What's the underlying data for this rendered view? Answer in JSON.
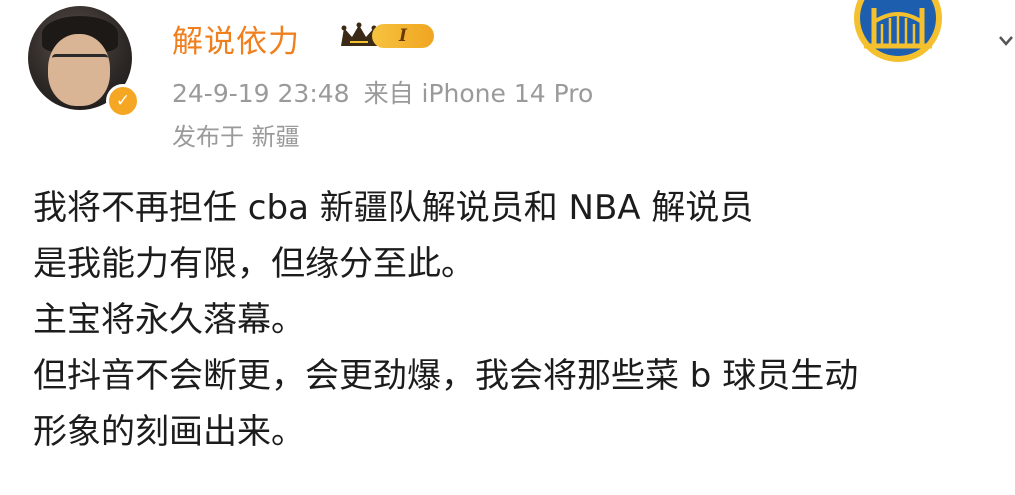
{
  "post": {
    "author": {
      "name": "解说依力",
      "vip_level": "I",
      "verified": true
    },
    "timestamp": "24-9-19 23:48",
    "source": "来自 iPhone 14 Pro",
    "location": "发布于 新疆",
    "content_lines": [
      "我将不再担任 cba 新疆队解说员和 NBA 解说员",
      "是我能力有限，但缘分至此。",
      "主宝将永久落幕。",
      "但抖音不会断更，会更劲爆，我会将那些菜 b 球员生动",
      "形象的刻画出来。"
    ]
  },
  "colors": {
    "username": "#f07f1e",
    "meta_text": "#9a9a9a",
    "verified_badge": "#f5a623",
    "vip_badge": "#f0a521",
    "team_logo_blue": "#1d5fae",
    "team_logo_gold": "#f5c02e"
  },
  "icons": {
    "verified": "verified-badge-icon",
    "vip": "crown-icon",
    "team": "team-logo-icon",
    "menu": "chevron-down-icon"
  }
}
